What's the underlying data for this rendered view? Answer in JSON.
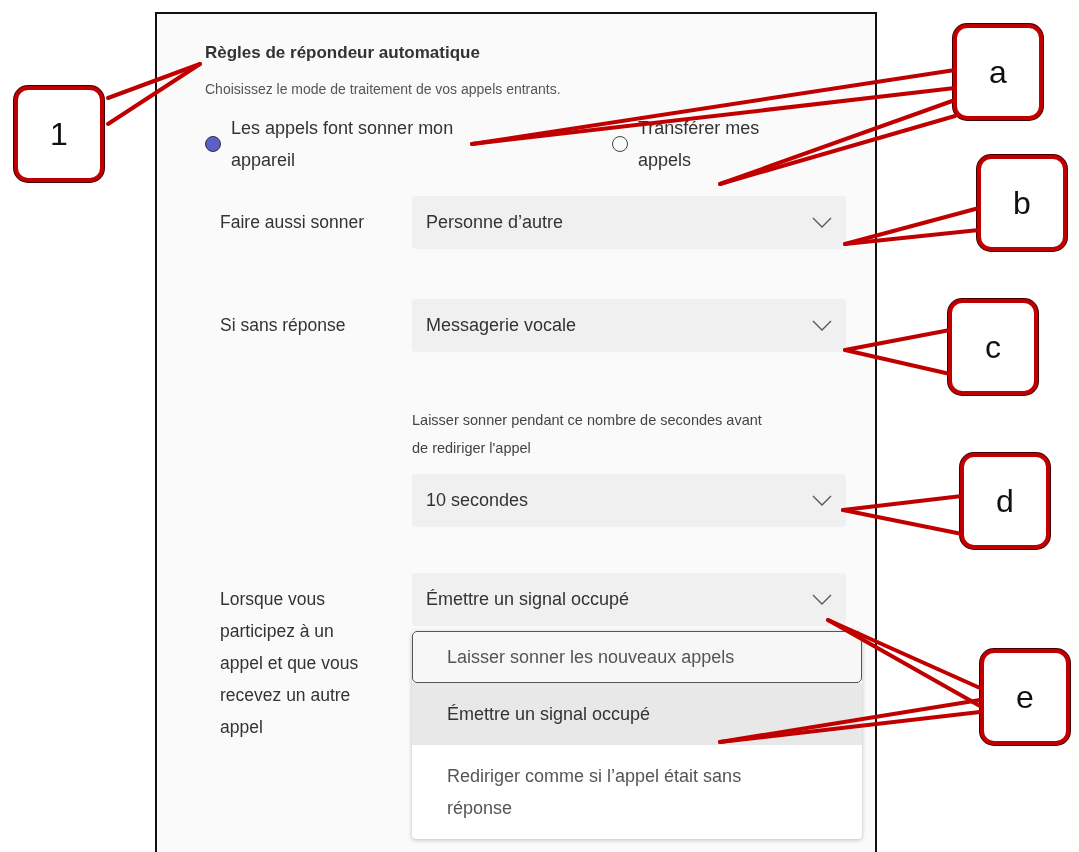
{
  "panel": {
    "title": "Règles de répondeur automatique",
    "description": "Choisissez le mode de traitement de vos appels entrants.",
    "radios": [
      {
        "label": "Les appels font sonner mon appareil",
        "selected": true
      },
      {
        "label": "Transférer mes appels",
        "selected": false
      }
    ],
    "fields": [
      {
        "kind": "select",
        "label": "Faire aussi sonner",
        "value": "Personne d’autre"
      },
      {
        "kind": "select",
        "label": "Si sans réponse",
        "value": "Messagerie vocale"
      },
      {
        "kind": "select",
        "hint": "Laisser sonner pendant ce nombre de secondes avant de rediriger l'appel",
        "value": "10 secondes"
      },
      {
        "kind": "select",
        "label": "Lorsque vous participez à un appel et que vous recevez un autre appel",
        "value": "Émettre un signal occupé",
        "expanded": true,
        "options": [
          {
            "label": "Laisser sonner les nouveaux appels",
            "focused": true,
            "selected": false
          },
          {
            "label": "Émettre un signal occupé",
            "focused": false,
            "selected": true
          },
          {
            "label": "Rediriger comme si l’appel était sans réponse",
            "focused": false,
            "selected": false
          }
        ]
      }
    ]
  },
  "callouts": [
    {
      "label": "1"
    },
    {
      "label": "a"
    },
    {
      "label": "b"
    },
    {
      "label": "c"
    },
    {
      "label": "d"
    },
    {
      "label": "e"
    }
  ]
}
